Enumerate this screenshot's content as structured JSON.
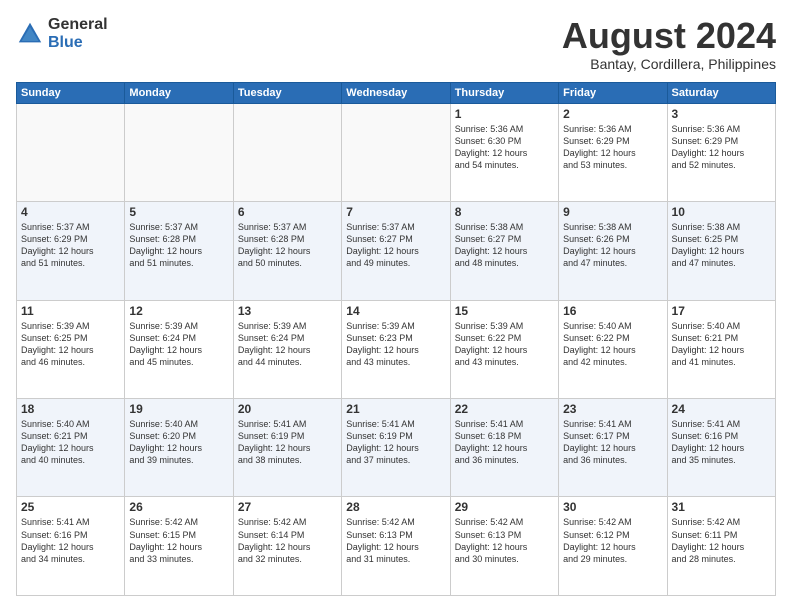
{
  "logo": {
    "general": "General",
    "blue": "Blue"
  },
  "title": "August 2024",
  "subtitle": "Bantay, Cordillera, Philippines",
  "headers": [
    "Sunday",
    "Monday",
    "Tuesday",
    "Wednesday",
    "Thursday",
    "Friday",
    "Saturday"
  ],
  "rows": [
    [
      {
        "day": "",
        "info": ""
      },
      {
        "day": "",
        "info": ""
      },
      {
        "day": "",
        "info": ""
      },
      {
        "day": "",
        "info": ""
      },
      {
        "day": "1",
        "info": "Sunrise: 5:36 AM\nSunset: 6:30 PM\nDaylight: 12 hours\nand 54 minutes."
      },
      {
        "day": "2",
        "info": "Sunrise: 5:36 AM\nSunset: 6:29 PM\nDaylight: 12 hours\nand 53 minutes."
      },
      {
        "day": "3",
        "info": "Sunrise: 5:36 AM\nSunset: 6:29 PM\nDaylight: 12 hours\nand 52 minutes."
      }
    ],
    [
      {
        "day": "4",
        "info": "Sunrise: 5:37 AM\nSunset: 6:29 PM\nDaylight: 12 hours\nand 51 minutes."
      },
      {
        "day": "5",
        "info": "Sunrise: 5:37 AM\nSunset: 6:28 PM\nDaylight: 12 hours\nand 51 minutes."
      },
      {
        "day": "6",
        "info": "Sunrise: 5:37 AM\nSunset: 6:28 PM\nDaylight: 12 hours\nand 50 minutes."
      },
      {
        "day": "7",
        "info": "Sunrise: 5:37 AM\nSunset: 6:27 PM\nDaylight: 12 hours\nand 49 minutes."
      },
      {
        "day": "8",
        "info": "Sunrise: 5:38 AM\nSunset: 6:27 PM\nDaylight: 12 hours\nand 48 minutes."
      },
      {
        "day": "9",
        "info": "Sunrise: 5:38 AM\nSunset: 6:26 PM\nDaylight: 12 hours\nand 47 minutes."
      },
      {
        "day": "10",
        "info": "Sunrise: 5:38 AM\nSunset: 6:25 PM\nDaylight: 12 hours\nand 47 minutes."
      }
    ],
    [
      {
        "day": "11",
        "info": "Sunrise: 5:39 AM\nSunset: 6:25 PM\nDaylight: 12 hours\nand 46 minutes."
      },
      {
        "day": "12",
        "info": "Sunrise: 5:39 AM\nSunset: 6:24 PM\nDaylight: 12 hours\nand 45 minutes."
      },
      {
        "day": "13",
        "info": "Sunrise: 5:39 AM\nSunset: 6:24 PM\nDaylight: 12 hours\nand 44 minutes."
      },
      {
        "day": "14",
        "info": "Sunrise: 5:39 AM\nSunset: 6:23 PM\nDaylight: 12 hours\nand 43 minutes."
      },
      {
        "day": "15",
        "info": "Sunrise: 5:39 AM\nSunset: 6:22 PM\nDaylight: 12 hours\nand 43 minutes."
      },
      {
        "day": "16",
        "info": "Sunrise: 5:40 AM\nSunset: 6:22 PM\nDaylight: 12 hours\nand 42 minutes."
      },
      {
        "day": "17",
        "info": "Sunrise: 5:40 AM\nSunset: 6:21 PM\nDaylight: 12 hours\nand 41 minutes."
      }
    ],
    [
      {
        "day": "18",
        "info": "Sunrise: 5:40 AM\nSunset: 6:21 PM\nDaylight: 12 hours\nand 40 minutes."
      },
      {
        "day": "19",
        "info": "Sunrise: 5:40 AM\nSunset: 6:20 PM\nDaylight: 12 hours\nand 39 minutes."
      },
      {
        "day": "20",
        "info": "Sunrise: 5:41 AM\nSunset: 6:19 PM\nDaylight: 12 hours\nand 38 minutes."
      },
      {
        "day": "21",
        "info": "Sunrise: 5:41 AM\nSunset: 6:19 PM\nDaylight: 12 hours\nand 37 minutes."
      },
      {
        "day": "22",
        "info": "Sunrise: 5:41 AM\nSunset: 6:18 PM\nDaylight: 12 hours\nand 36 minutes."
      },
      {
        "day": "23",
        "info": "Sunrise: 5:41 AM\nSunset: 6:17 PM\nDaylight: 12 hours\nand 36 minutes."
      },
      {
        "day": "24",
        "info": "Sunrise: 5:41 AM\nSunset: 6:16 PM\nDaylight: 12 hours\nand 35 minutes."
      }
    ],
    [
      {
        "day": "25",
        "info": "Sunrise: 5:41 AM\nSunset: 6:16 PM\nDaylight: 12 hours\nand 34 minutes."
      },
      {
        "day": "26",
        "info": "Sunrise: 5:42 AM\nSunset: 6:15 PM\nDaylight: 12 hours\nand 33 minutes."
      },
      {
        "day": "27",
        "info": "Sunrise: 5:42 AM\nSunset: 6:14 PM\nDaylight: 12 hours\nand 32 minutes."
      },
      {
        "day": "28",
        "info": "Sunrise: 5:42 AM\nSunset: 6:13 PM\nDaylight: 12 hours\nand 31 minutes."
      },
      {
        "day": "29",
        "info": "Sunrise: 5:42 AM\nSunset: 6:13 PM\nDaylight: 12 hours\nand 30 minutes."
      },
      {
        "day": "30",
        "info": "Sunrise: 5:42 AM\nSunset: 6:12 PM\nDaylight: 12 hours\nand 29 minutes."
      },
      {
        "day": "31",
        "info": "Sunrise: 5:42 AM\nSunset: 6:11 PM\nDaylight: 12 hours\nand 28 minutes."
      }
    ]
  ]
}
